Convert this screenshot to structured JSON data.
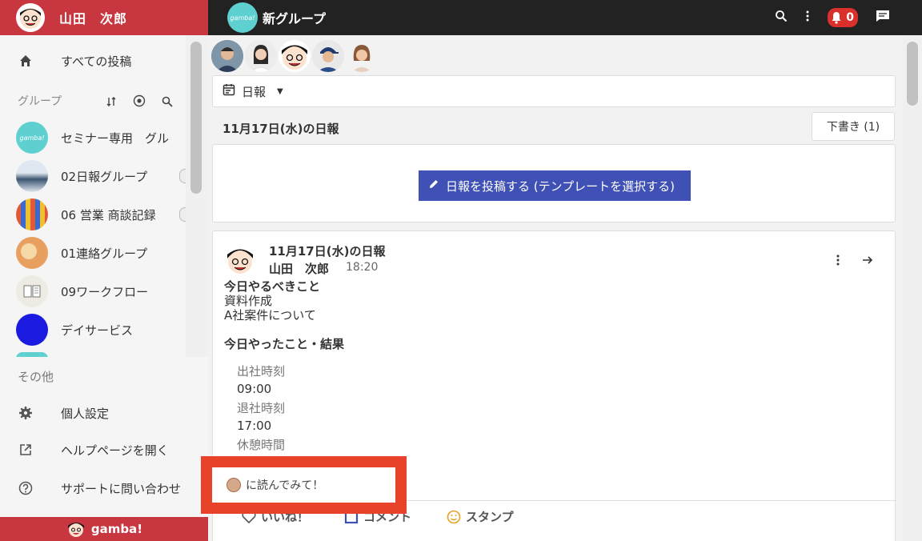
{
  "user": {
    "name": "山田　次郎"
  },
  "sidebar": {
    "all_posts": "すべての投稿",
    "groups_label": "グループ",
    "groups": [
      {
        "label": "セミナー専用　グル",
        "color": "#5fd0d0",
        "avatar_text": "gamba!"
      },
      {
        "label": "02日報グループ",
        "color": "#6a8fb8",
        "avatar_text": ""
      },
      {
        "label": "06 営業 商談記録",
        "color": "#e06040",
        "avatar_text": ""
      },
      {
        "label": "01連絡グループ",
        "color": "#e8a060",
        "avatar_text": ""
      },
      {
        "label": "09ワークフロー",
        "color": "#b0a090",
        "avatar_text": ""
      },
      {
        "label": "デイサービス",
        "color": "#1a1ae0",
        "avatar_text": ""
      }
    ],
    "other_label": "その他",
    "personal_settings": "個人設定",
    "open_help": "ヘルプページを開く",
    "contact_support": "サポートに問い合わせ",
    "brand": "gamba!"
  },
  "topbar": {
    "group_title": "新グループ",
    "group_icon_text": "gamba!",
    "notification_count": "0"
  },
  "main": {
    "filter_label": "日報",
    "date_heading": "11月17日(水)の日報",
    "draft_button": "下書き (1)",
    "post_button": "日報を投稿する (テンプレートを選択する)",
    "post": {
      "title": "11月17日(水)の日報",
      "author": "山田　次郎",
      "time": "18:20",
      "todo_heading": "今日やるべきこと",
      "todo_line1": "資料作成",
      "todo_line2": "A社案件について",
      "done_heading": "今日やったこと・結果",
      "field1_label": "出社時刻",
      "field1_value": "09:00",
      "field2_label": "退社時刻",
      "field2_value": "17:00",
      "field3_label": "休憩時間"
    },
    "actions": {
      "like": "いいね！",
      "comment": "コメント",
      "stamp": "スタンプ"
    },
    "read_request": "に読んでみて！"
  },
  "colors": {
    "header_red": "#c8373f",
    "topbar_dark": "#222222",
    "post_button_blue": "#3f51b5",
    "highlight_red": "#e8432a"
  }
}
